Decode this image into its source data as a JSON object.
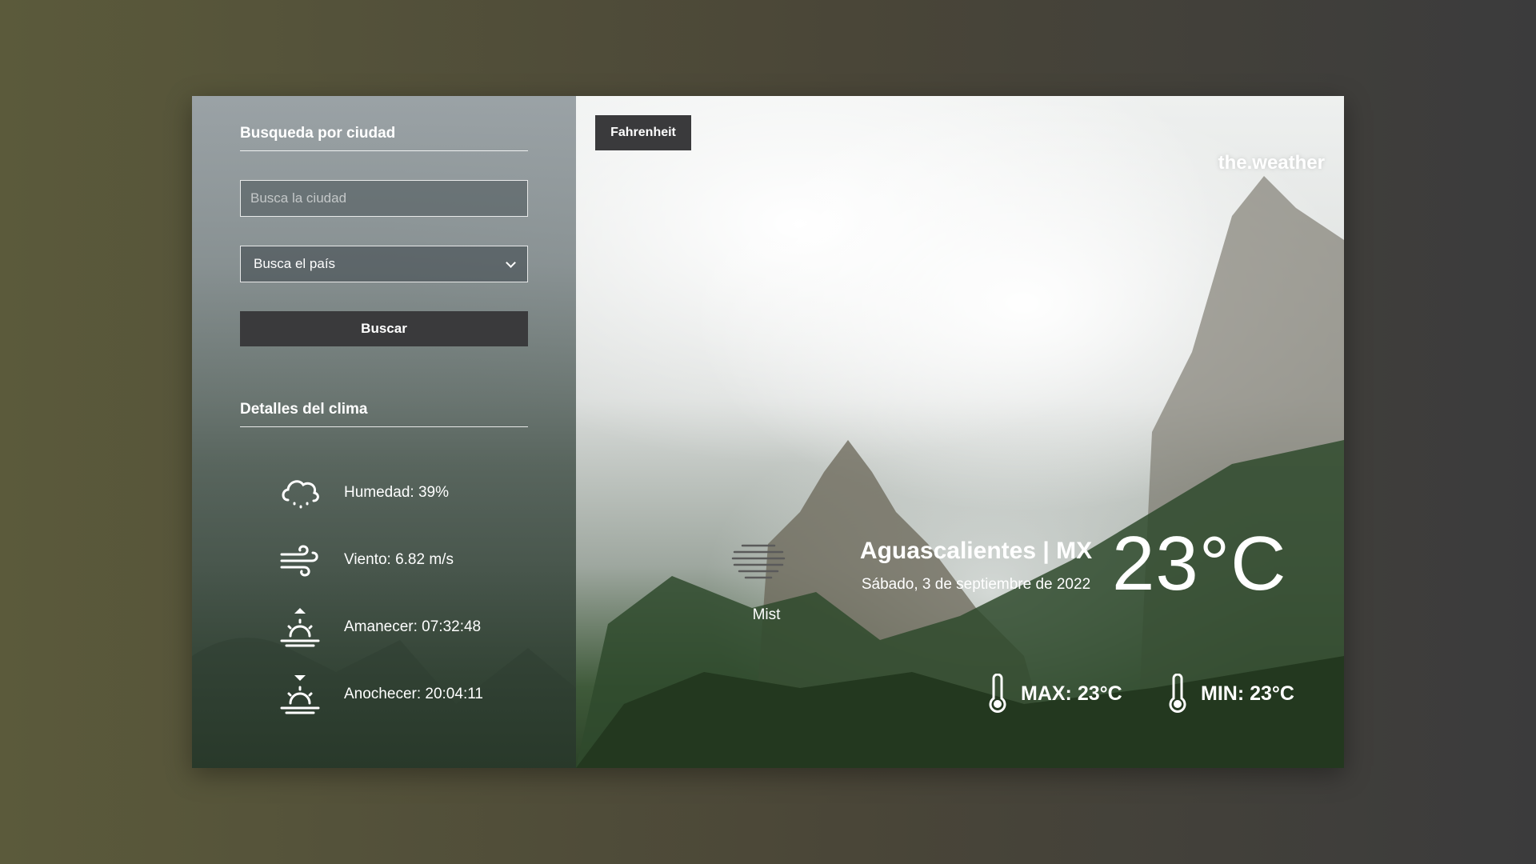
{
  "sidebar": {
    "search_title": "Busqueda por ciudad",
    "city_placeholder": "Busca la ciudad",
    "country_select_value": "Busca el país",
    "search_button": "Buscar",
    "details_title": "Detalles del clima",
    "details": [
      {
        "icon": "cloud-rain-icon",
        "text": "Humedad: 39%"
      },
      {
        "icon": "wind-icon",
        "text": "Viento: 6.82 m/s"
      },
      {
        "icon": "sunrise-icon",
        "text": "Amanecer: 07:32:48"
      },
      {
        "icon": "sunset-icon",
        "text": "Anochecer: 20:04:11"
      }
    ]
  },
  "main": {
    "unit_button": "Fahrenheit",
    "brand": "the.weather",
    "condition": {
      "icon": "mist-icon",
      "label": "Mist"
    },
    "city": "Aguascalientes | MX",
    "date": "Sábado, 3 de septiembre de 2022",
    "temperature": "23°C",
    "max": "MAX: 23°C",
    "min": "MIN: 23°C"
  }
}
